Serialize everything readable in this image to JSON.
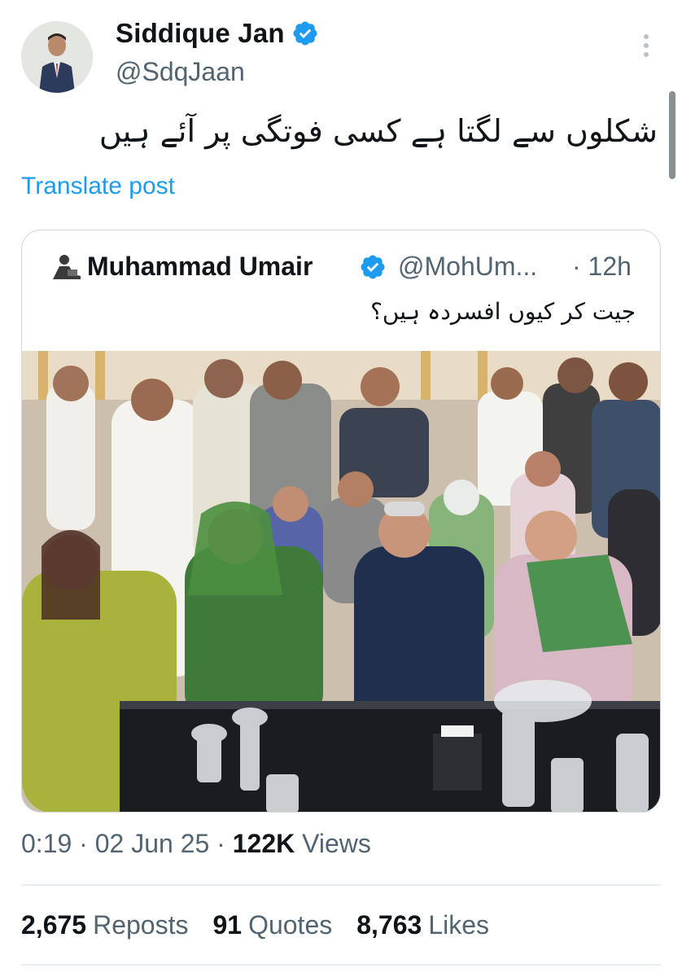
{
  "post": {
    "author_name": "Siddique Jan",
    "author_handle": "@SdqJaan",
    "text": "شکلوں سے لگتا ہے کسی فوتگی پر آئے ہیں",
    "translate_label": "Translate post"
  },
  "quoted": {
    "author_name": "Muhammad Umair",
    "author_handle": "@MohUm...",
    "time": "· 12h",
    "text": "جیت کر کیوں افسردہ ہیں؟"
  },
  "meta": {
    "time": "0:19",
    "sep1": " · ",
    "date": "02 Jun 25",
    "sep2": " · ",
    "views_count": "122K",
    "views_label": "Views"
  },
  "stats": {
    "reposts_count": "2,675",
    "reposts_label": "Reposts",
    "quotes_count": "91",
    "quotes_label": "Quotes",
    "likes_count": "8,763",
    "likes_label": "Likes"
  },
  "colors": {
    "link_blue": "#1d9bf0",
    "verified_blue": "#1d9bf0",
    "secondary_text": "#536471",
    "border": "#cfd9de"
  },
  "icons": {
    "verified": "verified-badge-icon",
    "more": "more-vertical-icon"
  }
}
